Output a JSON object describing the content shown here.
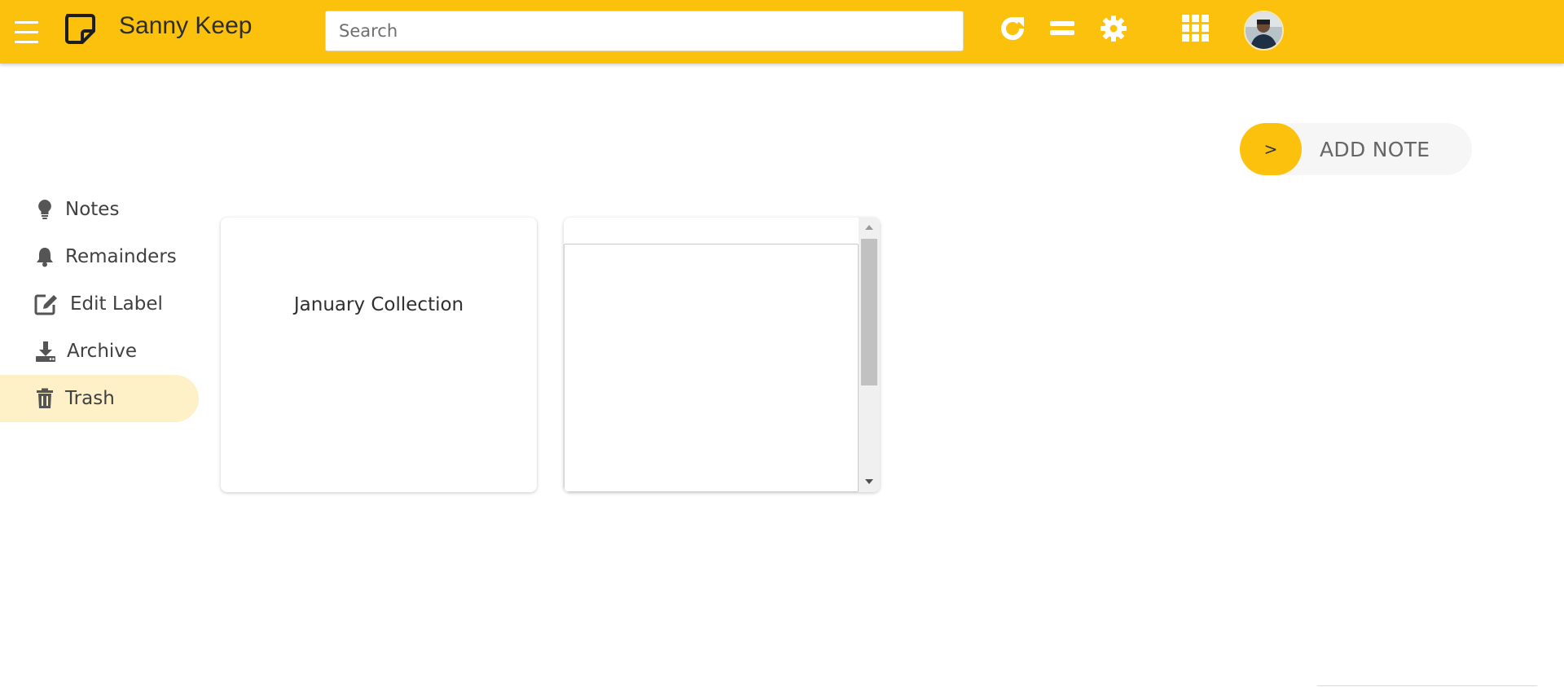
{
  "colors": {
    "accent": "#fbc10d",
    "active_nav_bg": "#fef0c7",
    "add_note_bg": "#f6f6f6"
  },
  "header": {
    "menu_icon": "hamburger-menu-icon",
    "logo_icon": "sticky-note-icon",
    "title": "Sanny Keep",
    "search": {
      "placeholder": "Search",
      "value": ""
    },
    "actions": [
      {
        "name": "refresh",
        "icon": "refresh-icon"
      },
      {
        "name": "list-view",
        "icon": "list-view-icon"
      },
      {
        "name": "settings",
        "icon": "gear-icon"
      },
      {
        "name": "apps",
        "icon": "apps-grid-icon"
      }
    ],
    "avatar_icon": "user-avatar"
  },
  "add_note": {
    "arrow": ">",
    "label": "ADD NOTE"
  },
  "sidebar": {
    "active_index": 4,
    "items": [
      {
        "label": "Notes",
        "icon": "lightbulb-icon"
      },
      {
        "label": "Remainders",
        "icon": "bell-icon"
      },
      {
        "label": "Edit Label",
        "icon": "edit-icon"
      },
      {
        "label": "Archive",
        "icon": "archive-download-icon"
      },
      {
        "label": "Trash",
        "icon": "trash-icon"
      }
    ]
  },
  "notes": [
    {
      "title": "January Collection"
    },
    {
      "body": ""
    }
  ]
}
